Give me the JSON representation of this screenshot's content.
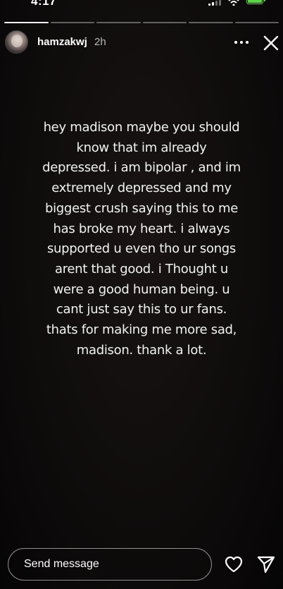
{
  "status_bar": {
    "time": "4:17",
    "icons": [
      "signal-icon",
      "wifi-icon",
      "battery-icon"
    ],
    "battery_color": "#5fd34a"
  },
  "story": {
    "segments_total": 6,
    "segments_done": 1,
    "user": {
      "username": "hamzakwj",
      "time_ago": "2h"
    },
    "text_lines": [
      "hey madison maybe you should",
      "know that im already",
      "depressed. i am bipolar , and im",
      "extremely depressed and my",
      "biggest crush saying this to me",
      "has broke my heart. i always",
      "supported u even tho ur songs",
      "arent that good.  i Thought u",
      "were a good human being. u",
      "cant just say this to ur fans.",
      "thats for making me more sad,",
      "madison. thank a lot."
    ],
    "background_color": "#0f0c0c"
  },
  "header_actions": {
    "more_icon": "more-dots-icon",
    "close_icon": "close-icon"
  },
  "reply_bar": {
    "placeholder": "Send message",
    "like_icon": "heart-icon",
    "share_icon": "send-icon"
  }
}
